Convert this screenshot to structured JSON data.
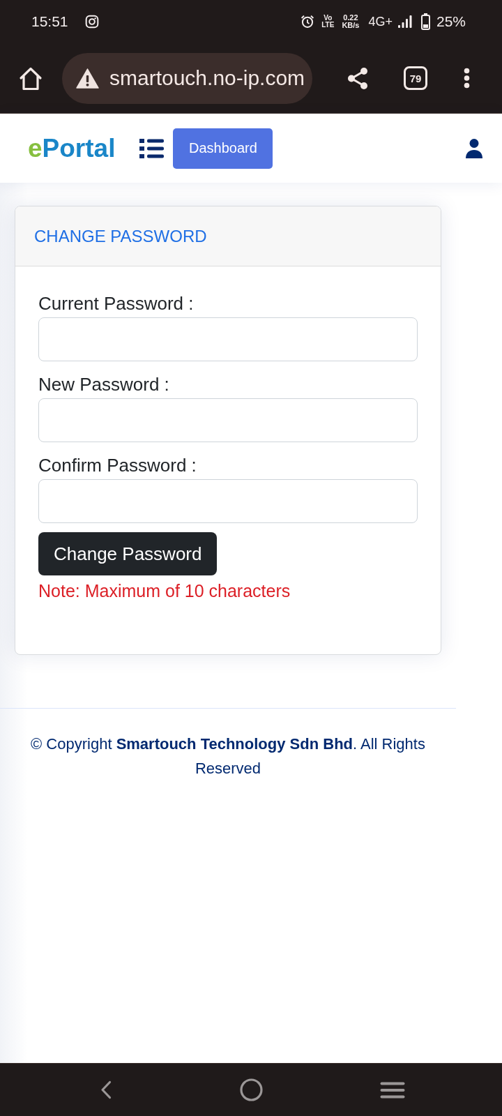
{
  "status_bar": {
    "time": "15:51",
    "volte": {
      "top": "Vo",
      "bottom": "LTE"
    },
    "data_rate": {
      "value": "0.22",
      "unit": "KB/s"
    },
    "network": "4G+",
    "battery_percent": "25%"
  },
  "browser": {
    "url": "smartouch.no-ip.com",
    "tab_count": "79"
  },
  "header": {
    "logo": {
      "accent": "e",
      "rest": "Portal"
    },
    "nav_button": "Dashboard"
  },
  "card": {
    "title": "CHANGE PASSWORD",
    "fields": [
      {
        "label": "Current Password :"
      },
      {
        "label": "New Password :"
      },
      {
        "label": "Confirm Password :"
      }
    ],
    "submit_button": "Change Password",
    "note": "Note: Maximum of 10 characters"
  },
  "footer": {
    "copyright": "© Copyright **Smartouch Technology Sdn Bhd**. All Rights Reserved"
  }
}
